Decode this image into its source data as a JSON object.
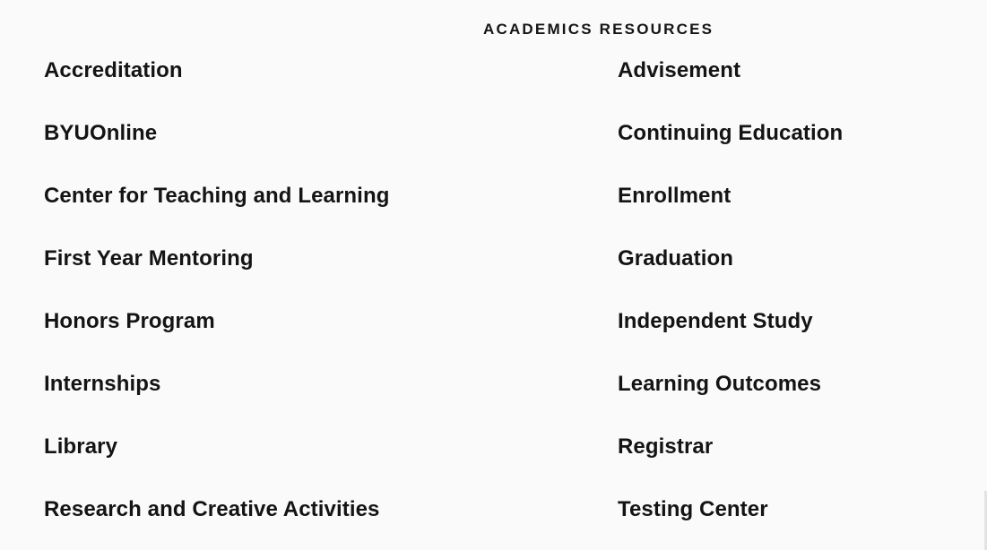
{
  "academics": {
    "heading": "ACADEMICS RESOURCES",
    "left_links": [
      "Accreditation",
      "BYUOnline",
      "Center for Teaching and Learning",
      "First Year Mentoring",
      "Honors Program",
      "Internships",
      "Library",
      "Research and Creative Activities"
    ],
    "right_links": [
      "Advisement",
      "Continuing Education",
      "Enrollment",
      "Graduation",
      "Independent Study",
      "Learning Outcomes",
      "Registrar",
      "Testing Center"
    ]
  }
}
